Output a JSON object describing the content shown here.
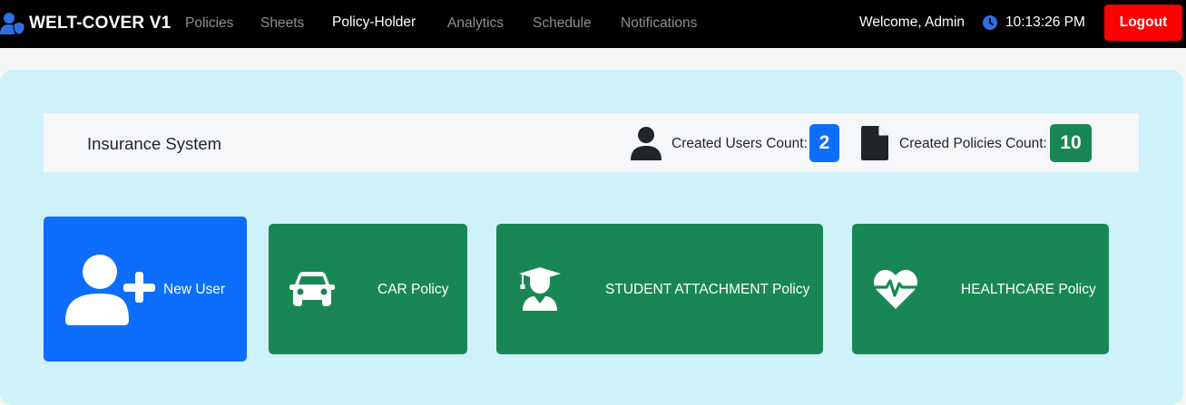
{
  "navbar": {
    "brand": "WELT-COVER V1",
    "links": [
      {
        "label": "Policies",
        "active": false
      },
      {
        "label": "Sheets",
        "active": false
      },
      {
        "label": "Policy-Holder",
        "active": true
      },
      {
        "label": "Analytics",
        "active": false
      },
      {
        "label": "Schedule",
        "active": false
      },
      {
        "label": "Notifications",
        "active": false
      }
    ],
    "welcome": "Welcome, Admin",
    "time": "10:13:26 PM",
    "logout": "Logout"
  },
  "info_bar": {
    "title": "Insurance System",
    "users_label": "Created Users Count:",
    "users_count": "2",
    "policies_label": "Created Policies Count:",
    "policies_count": "10"
  },
  "cards": [
    {
      "label": "New User",
      "icon": "user-plus-icon"
    },
    {
      "label": "CAR Policy",
      "icon": "car-icon"
    },
    {
      "label": "STUDENT ATTACHMENT Policy",
      "icon": "graduate-icon"
    },
    {
      "label": "HEALTHCARE Policy",
      "icon": "heart-pulse-icon"
    }
  ],
  "colors": {
    "navbar": "#000000",
    "primary": "#0d6efd",
    "success": "#198754",
    "danger": "#ff0000",
    "panel": "#cff1fa",
    "info_bar": "#f6f7f9"
  }
}
